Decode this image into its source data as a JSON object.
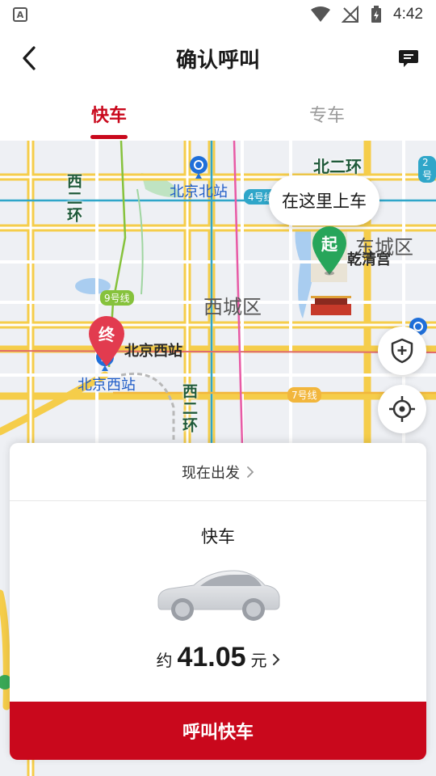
{
  "status_bar": {
    "app_icon_letter": "A",
    "time": "4:42"
  },
  "header": {
    "title": "确认呼叫",
    "back_icon": "chevron-left-icon",
    "message_icon": "message-icon"
  },
  "tabs": [
    {
      "label": "快车",
      "selected": true
    },
    {
      "label": "专车",
      "selected": false
    }
  ],
  "map": {
    "labels": {
      "beijing_north": "北京北站",
      "xicheng": "西城区",
      "dongcheng": "东城区",
      "qianqing": "乾清宫",
      "beijing_west_station": "北京西站",
      "beijing_west": "北京西站",
      "west_2nd_ring_top": "西二环",
      "west_2nd_ring_bottom": "西二环",
      "north_2nd_ring": "北二环"
    },
    "metro_badges": {
      "line4": "4号线",
      "line9": "9号线",
      "line7": "7号线",
      "line2": "2号"
    },
    "pickup_bubble": "在这里上车",
    "start_pin": "起",
    "end_pin": "终",
    "colors": {
      "start_pin": "#27a55a",
      "end_pin": "#e23b4f",
      "road_major": "#f5cd4a",
      "metro_line4": "#2fa6c9",
      "metro_line9": "#86c23c",
      "metro_line7": "#f2b63c"
    }
  },
  "card": {
    "depart_label": "现在出发",
    "car_type": "快车",
    "price_prefix": "约",
    "price_value": "41.05",
    "price_unit": "元",
    "call_button": "呼叫快车"
  },
  "theme": {
    "accent": "#c9081c"
  }
}
